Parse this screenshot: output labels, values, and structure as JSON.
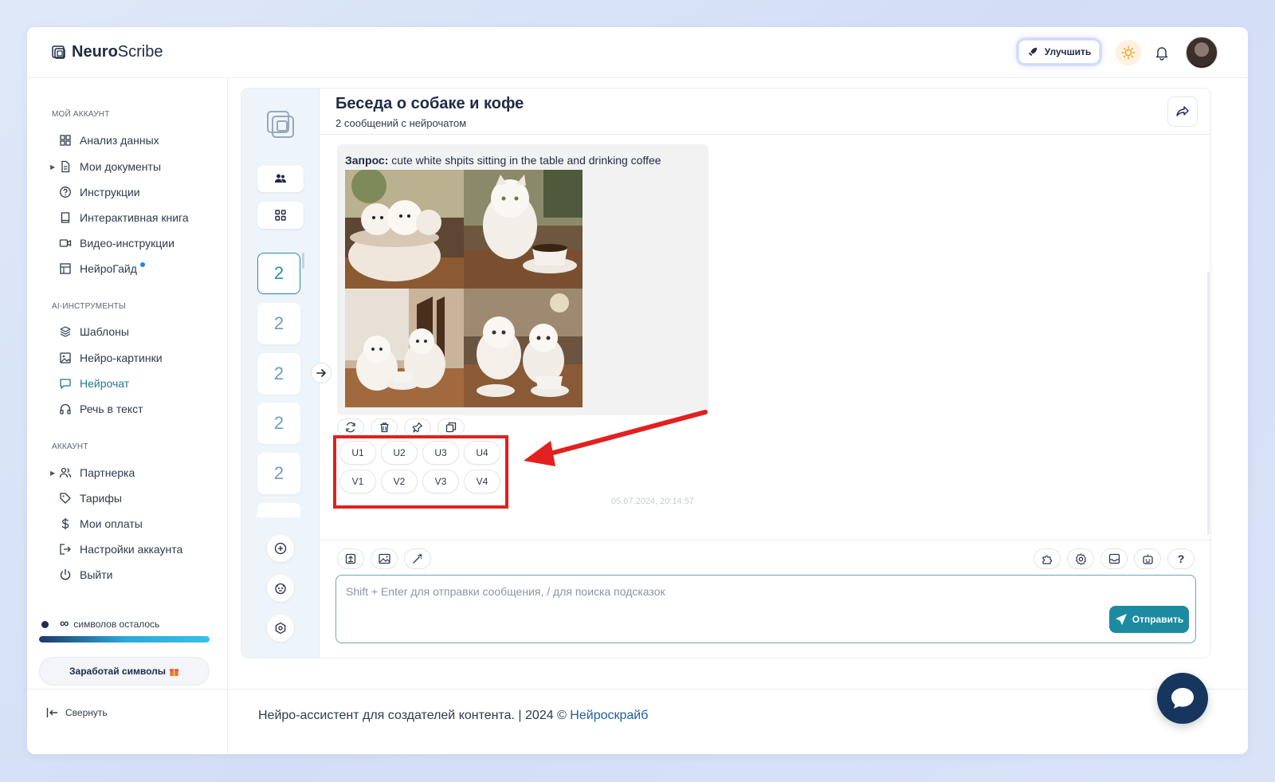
{
  "brand": {
    "name_bold": "Neuro",
    "name_rest": "Scribe"
  },
  "topbar": {
    "upgrade_label": "Улучшить"
  },
  "sidebar": {
    "section_account": "МОЙ АККАУНТ",
    "account_items": [
      {
        "label": "Анализ данных",
        "icon": "grid-icon"
      },
      {
        "label": "Мои документы",
        "icon": "document-icon"
      },
      {
        "label": "Инструкции",
        "icon": "question-icon"
      },
      {
        "label": "Интерактивная книга",
        "icon": "book-icon"
      },
      {
        "label": "Видео-инструкции",
        "icon": "video-icon"
      },
      {
        "label": "НейроГайд",
        "icon": "table-icon"
      }
    ],
    "section_ai": "AI-ИНСТРУМЕНТЫ",
    "ai_items": [
      {
        "label": "Шаблоны",
        "icon": "layers-icon"
      },
      {
        "label": "Нейро-картинки",
        "icon": "image-icon"
      },
      {
        "label": "Нейрочат",
        "icon": "chat-icon"
      },
      {
        "label": "Речь в текст",
        "icon": "headphones-icon"
      }
    ],
    "section_profile": "АККАУНТ",
    "profile_items": [
      {
        "label": "Партнерка",
        "icon": "users-icon"
      },
      {
        "label": "Тарифы",
        "icon": "tag-icon"
      },
      {
        "label": "Мои оплаты",
        "icon": "dollar-icon"
      },
      {
        "label": "Настройки аккаунта",
        "icon": "logout-box-icon"
      },
      {
        "label": "Выйти",
        "icon": "power-icon"
      }
    ],
    "credits_symbol": "∞",
    "credits_label": "символов осталось",
    "credits_fraction": 1.0,
    "earn_label": "Заработай символы",
    "collapse_label": "Свернуть"
  },
  "rail": {
    "chat_counts": [
      "2",
      "2",
      "2",
      "2",
      "2"
    ]
  },
  "chat": {
    "title": "Беседа о собаке и кофе",
    "subtitle": "2 сообщений с нейрочатом",
    "prompt_label": "Запрос:",
    "prompt_text": "cute white shpits sitting in the table and drinking coffee",
    "upscale_buttons": [
      "U1",
      "U2",
      "U3",
      "U4"
    ],
    "variation_buttons": [
      "V1",
      "V2",
      "V3",
      "V4"
    ],
    "timestamp": "05.07.2024, 20:14:57",
    "help_symbol": "?",
    "input_placeholder": "Shift + Enter для отправки сообщения, / для поиска подсказок",
    "send_label": "Отправить"
  },
  "footer": {
    "text": "Нейро-ассистент для создателей контента.  | 2024 © ",
    "link": "Нейроскрайб"
  },
  "colors": {
    "accent": "#1c8aa0",
    "highlight_red": "#e1201f",
    "brand_dark": "#16365d"
  }
}
